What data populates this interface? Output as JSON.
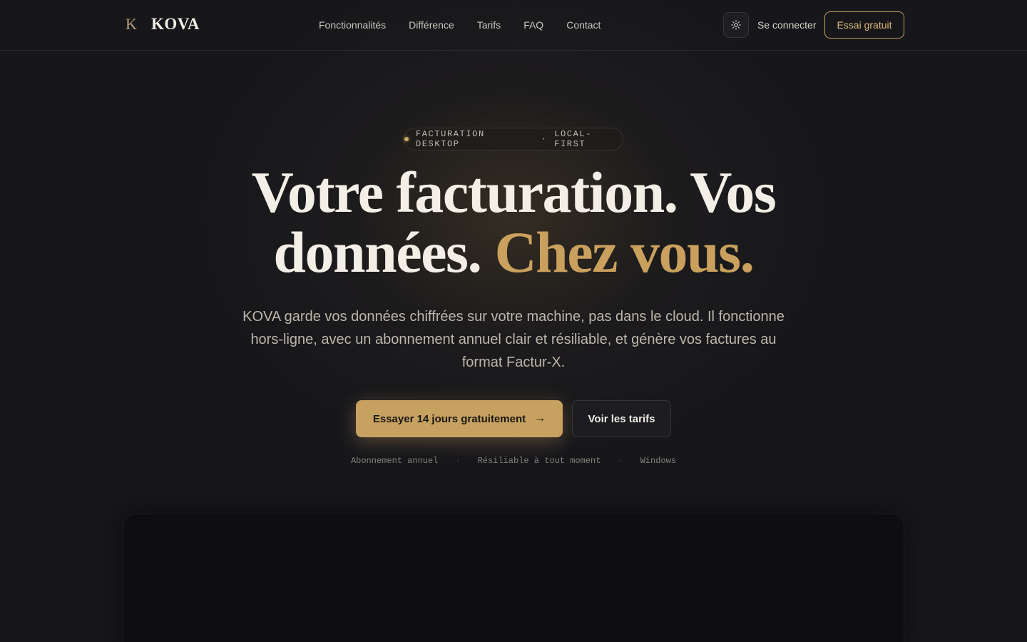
{
  "brand": {
    "mark": "K",
    "name": "KOVA"
  },
  "nav": {
    "items": [
      {
        "label": "Fonctionnalités"
      },
      {
        "label": "Différence"
      },
      {
        "label": "Tarifs"
      },
      {
        "label": "FAQ"
      },
      {
        "label": "Contact"
      }
    ]
  },
  "header": {
    "theme_icon": "sun-icon",
    "login_label": "Se connecter",
    "trial_label": "Essai gratuit"
  },
  "hero": {
    "badge_left": "FACTURATION DESKTOP",
    "badge_sep": "·",
    "badge_right": "LOCAL-FIRST",
    "headline_line1": "Votre facturation. Vos",
    "headline_line2": "données.",
    "headline_accent": "Chez vous.",
    "subtitle": "KOVA garde vos données chiffrées sur votre machine, pas dans le cloud. Il fonctionne hors-ligne, avec un abonnement annuel clair et résiliable, et génère vos factures au format Factur-X.",
    "cta_primary": "Essayer 14 jours gratuitement",
    "cta_primary_icon": "arrow-right-icon",
    "cta_secondary": "Voir les tarifs",
    "features": [
      "Abonnement annuel",
      "Résiliable à tout moment",
      "Windows"
    ],
    "feature_sep": "·"
  },
  "colors": {
    "background": "#17171b",
    "accent": "#c6a160",
    "text": "#f3efe7"
  }
}
